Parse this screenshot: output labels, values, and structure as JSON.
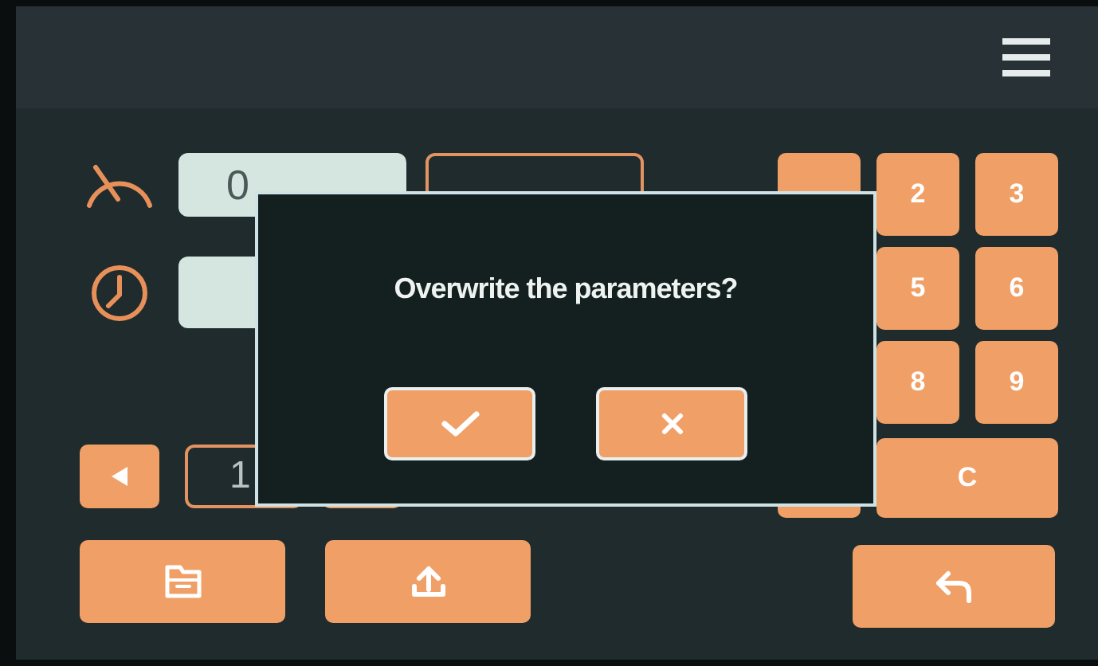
{
  "parameters": [
    {
      "kind": "gauge",
      "value": "0",
      "target": {
        "kind": "outlined"
      }
    },
    {
      "kind": "clock"
    }
  ],
  "pager": {
    "page": "1"
  },
  "keypad": [
    {
      "kind": "covered"
    },
    {
      "kind": "digit",
      "label": "2"
    },
    {
      "kind": "digit",
      "label": "3"
    },
    {
      "kind": "digit",
      "label": "5"
    },
    {
      "kind": "digit",
      "label": "6"
    },
    {
      "kind": "digit",
      "label": "8"
    },
    {
      "kind": "digit",
      "label": "9"
    },
    {
      "kind": "covered"
    },
    {
      "kind": "clear",
      "label": "C"
    }
  ],
  "actions": [
    {
      "kind": "folder"
    },
    {
      "kind": "upload"
    },
    {
      "kind": "back"
    }
  ],
  "dialog": {
    "message": "Overwrite the parameters?",
    "buttons": [
      {
        "kind": "confirm"
      },
      {
        "kind": "cancel"
      }
    ]
  }
}
